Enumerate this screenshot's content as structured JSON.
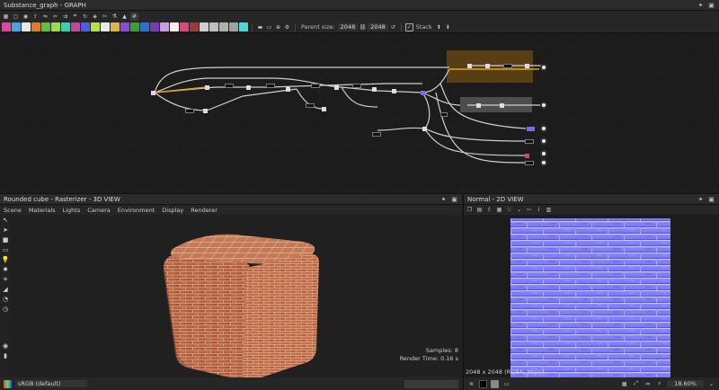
{
  "graph_panel": {
    "title": "Substance_graph - GRAPH",
    "parent_size_label": "Parent size:",
    "parent_size_value": "2048",
    "size_value": "2048",
    "stack_label": "Stack",
    "swatch_colors": [
      "#d94aa0",
      "#4aa3d9",
      "#e6e6e6",
      "#e07b2a",
      "#5fbf3a",
      "#9bdc4a",
      "#3ad0b0",
      "#c04a9a",
      "#4a5fd9",
      "#b8e04a",
      "#eaeaea",
      "#d9b84a",
      "#8a4ad9",
      "#3a9f3a",
      "#2f6fd0",
      "#7a3ab0",
      "#c7a0e0",
      "#f0f0f0",
      "#d94a7a",
      "#9a3a3a",
      "#cfcfcf",
      "#c0c0c0",
      "#b0b0b0",
      "#a0a0a0",
      "#4ad9d9"
    ]
  },
  "view3d_panel": {
    "title": "Rounded cube - Rasterizer - 3D VIEW",
    "menu": [
      "Scene",
      "Materials",
      "Lights",
      "Camera",
      "Environment",
      "Display",
      "Renderer"
    ],
    "samples": "Samples: 8",
    "render_time": "Render Time: 0.16 s",
    "colorspace": "sRGB (default)"
  },
  "view2d_panel": {
    "title": "Normal - 2D VIEW",
    "resolution": "2048 x 2048 (RGBA, 8bpc)",
    "zoom": "18.60%"
  },
  "icons": {
    "pin": "pin-icon",
    "maximize": "maximize-icon"
  }
}
